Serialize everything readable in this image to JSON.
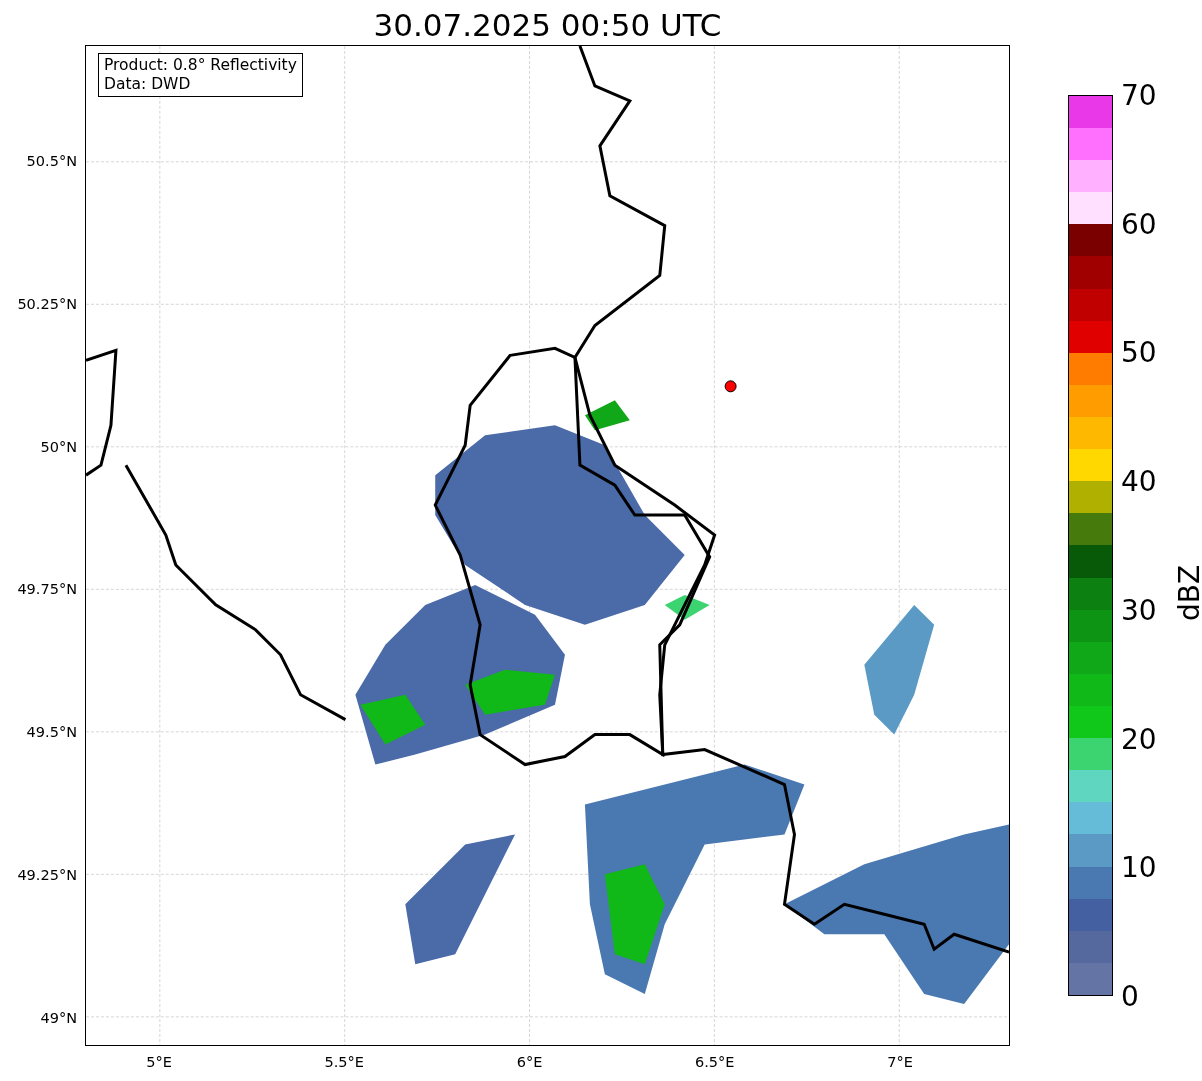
{
  "title": "30.07.2025 00:50 UTC",
  "info_box": {
    "lines": [
      "Product: 0.8° Reflectivity",
      "Data: DWD"
    ]
  },
  "map": {
    "y_ticks": [
      "50.5°N",
      "50.25°N",
      "50°N",
      "49.75°N",
      "49.5°N",
      "49.25°N",
      "49°N"
    ],
    "x_ticks": [
      "5°E",
      "5.5°E",
      "6°E",
      "6.5°E",
      "7°E"
    ]
  },
  "colorbar": {
    "label": "dBZ",
    "ticks": [
      "70",
      "60",
      "50",
      "40",
      "30",
      "20",
      "10",
      "0"
    ],
    "bands": [
      {
        "color": "#6474a4"
      },
      {
        "color": "#56699f"
      },
      {
        "color": "#4460a0"
      },
      {
        "color": "#4a78b0"
      },
      {
        "color": "#5a9ac4"
      },
      {
        "color": "#64bcd8"
      },
      {
        "color": "#5fd6c0"
      },
      {
        "color": "#3cd470"
      },
      {
        "color": "#10c81a"
      },
      {
        "color": "#10b818"
      },
      {
        "color": "#10a818"
      },
      {
        "color": "#0e9414"
      },
      {
        "color": "#0c8010"
      },
      {
        "color": "#085a08"
      },
      {
        "color": "#467a0c"
      },
      {
        "color": "#b0b000"
      },
      {
        "color": "#ffd800"
      },
      {
        "color": "#ffb800"
      },
      {
        "color": "#ff9c00"
      },
      {
        "color": "#ff7c00"
      },
      {
        "color": "#e00000"
      },
      {
        "color": "#c00000"
      },
      {
        "color": "#a00000"
      },
      {
        "color": "#7a0000"
      },
      {
        "color": "#ffe0ff"
      },
      {
        "color": "#ffb0ff"
      },
      {
        "color": "#ff70ff"
      },
      {
        "color": "#e838e8"
      }
    ]
  }
}
